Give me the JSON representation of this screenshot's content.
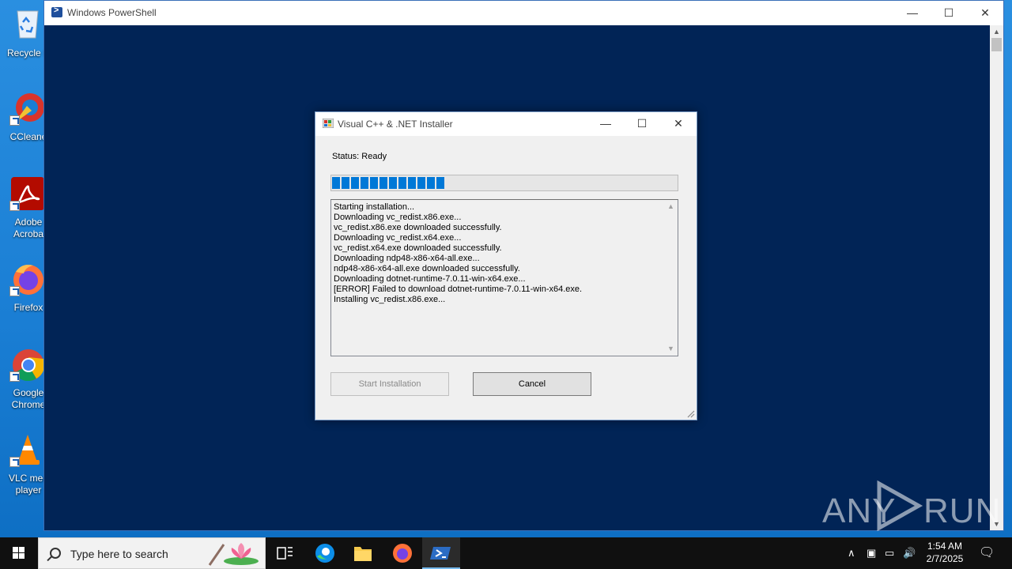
{
  "desktop": {
    "icons": [
      {
        "label": "Recycle B"
      },
      {
        "label": "CCleane"
      },
      {
        "label": "Adobe Acroba"
      },
      {
        "label": "Firefox"
      },
      {
        "label": "Google Chrome"
      },
      {
        "label": "VLC med player"
      }
    ]
  },
  "powershell": {
    "title": "Windows PowerShell",
    "background": "#012456"
  },
  "dialog": {
    "title": "Visual C++ & .NET Installer",
    "status": "Status: Ready",
    "progress_fraction": 0.33,
    "progress_blocks": 12,
    "log_lines": [
      "Starting installation...",
      "Downloading vc_redist.x86.exe...",
      "vc_redist.x86.exe downloaded successfully.",
      "Downloading vc_redist.x64.exe...",
      "vc_redist.x64.exe downloaded successfully.",
      "Downloading ndp48-x86-x64-all.exe...",
      "ndp48-x86-x64-all.exe downloaded successfully.",
      "Downloading dotnet-runtime-7.0.11-win-x64.exe...",
      "[ERROR] Failed to download dotnet-runtime-7.0.11-win-x64.exe.",
      "Installing vc_redist.x86.exe..."
    ],
    "start_button": "Start Installation",
    "cancel_button": "Cancel",
    "accent": "#0078d7"
  },
  "taskbar": {
    "search_placeholder": "Type here to search",
    "time": "1:54 AM",
    "date": "2/7/2025"
  },
  "watermark": {
    "left": "ANY",
    "right": "RUN"
  }
}
